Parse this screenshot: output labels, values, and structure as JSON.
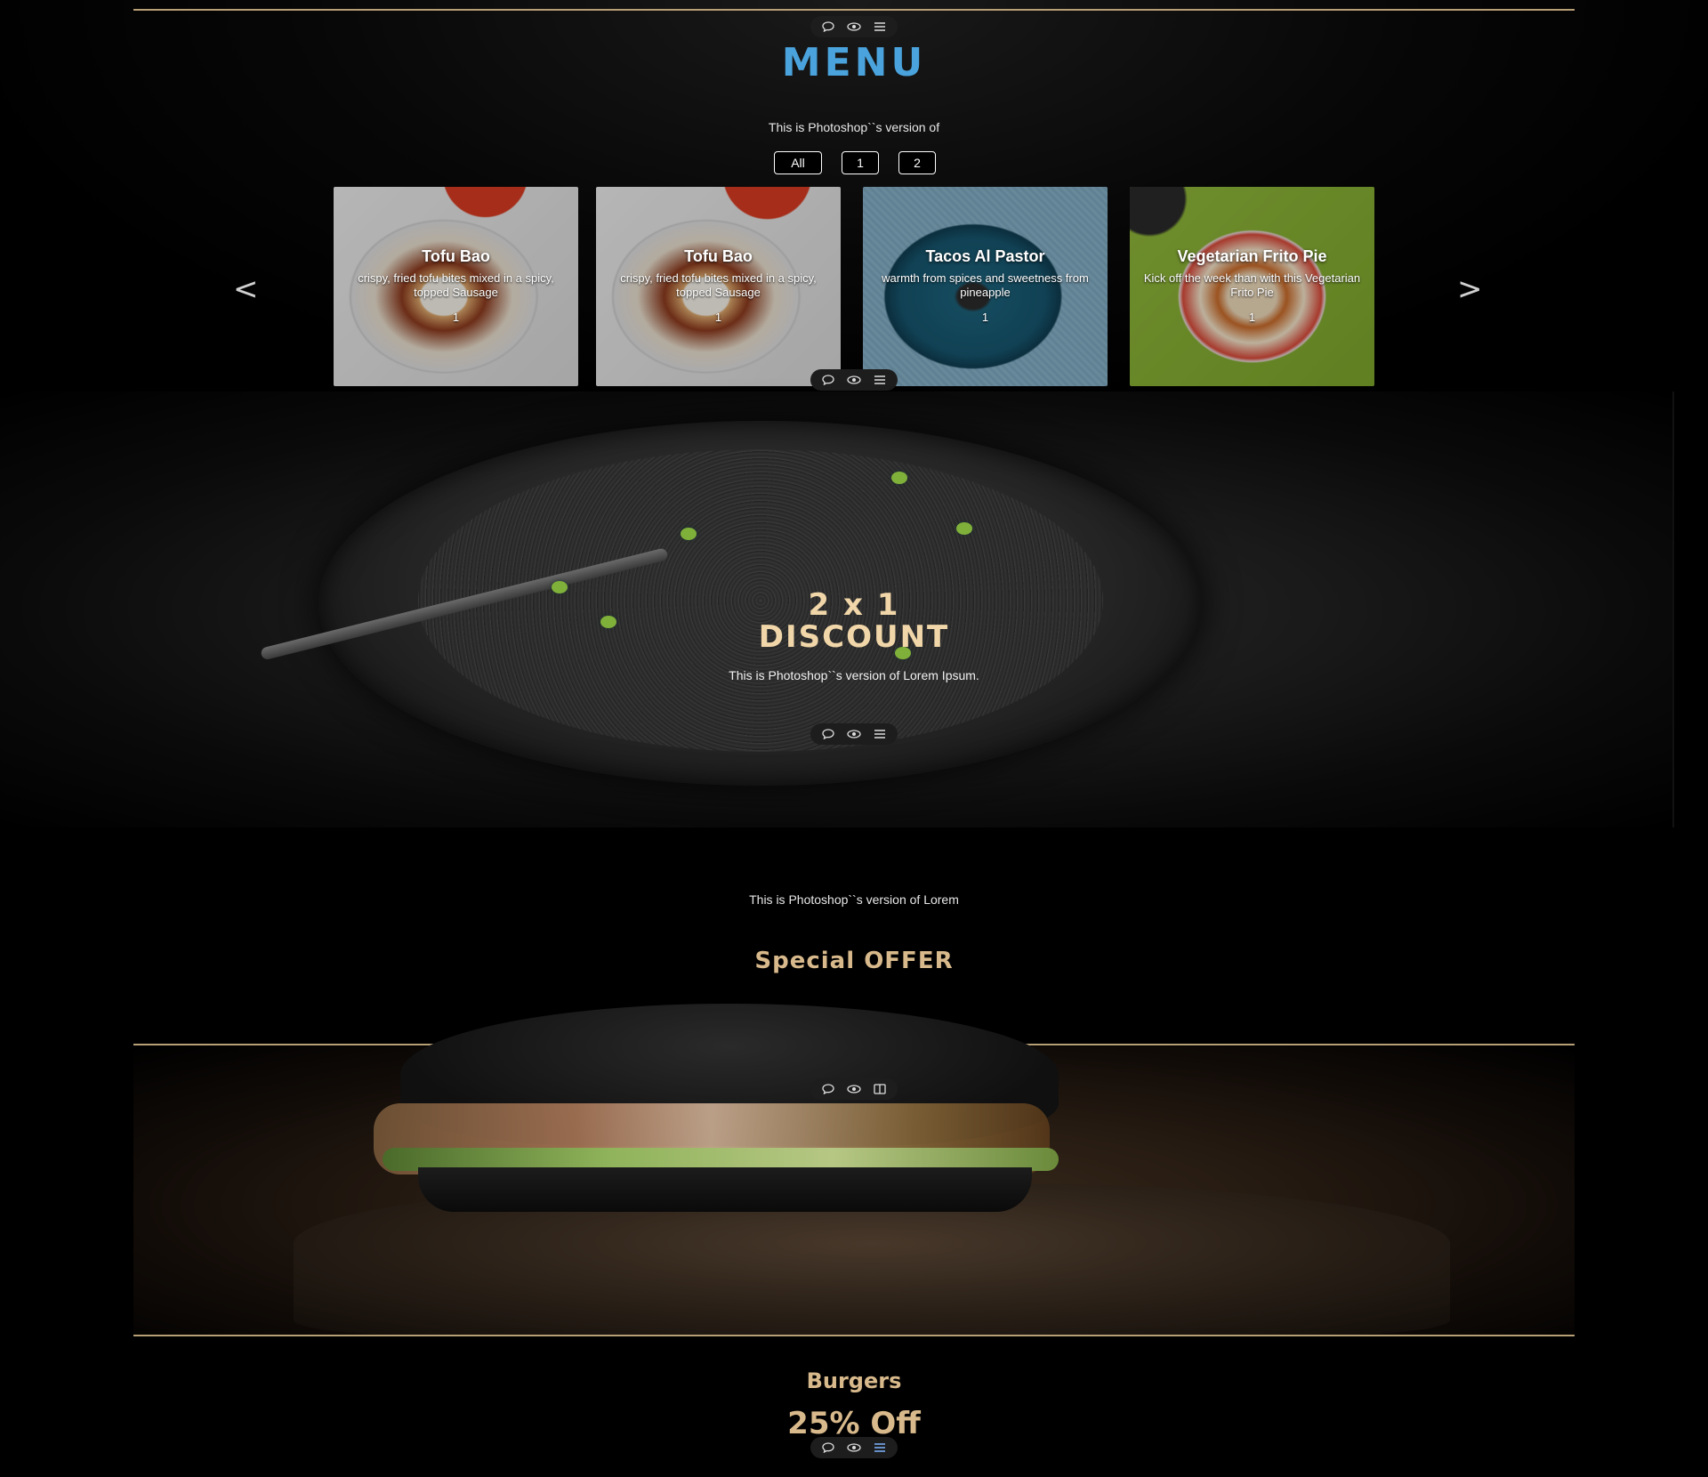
{
  "menu": {
    "title": "MENU",
    "subtitle": "This is Photoshop``s version of",
    "filters": [
      "All",
      "1",
      "2"
    ],
    "prev_icon": "<",
    "next_icon": ">",
    "cards": [
      {
        "title": "Tofu Bao",
        "desc": "crispy, fried tofu bites mixed in a spicy, topped Sausage",
        "num": "1"
      },
      {
        "title": "Tofu Bao",
        "desc": "crispy, fried tofu bites mixed in a spicy, topped Sausage",
        "num": "1"
      },
      {
        "title": "Tacos Al Pastor",
        "desc": "warmth from spices and sweetness from pineapple",
        "num": "1"
      },
      {
        "title": "Vegetarian Frito Pie",
        "desc": "Kick off the week than with this Vegetarian Frito Pie",
        "num": "1"
      }
    ]
  },
  "discount": {
    "line1": "2 x 1",
    "line2": "DISCOUNT",
    "subtitle": "This is Photoshop``s version of Lorem Ipsum."
  },
  "special": {
    "subtitle": "This is Photoshop``s version of Lorem",
    "title": "Special OFFER"
  },
  "burgers": {
    "title": "Burgers",
    "offer": "25% Off"
  },
  "toolbar_icons": [
    "comment-icon",
    "eye-icon",
    "list-icon"
  ],
  "colors": {
    "menu_title": "#4aa3dc",
    "gold": "#d8b98b",
    "rule": "#b79f76"
  }
}
